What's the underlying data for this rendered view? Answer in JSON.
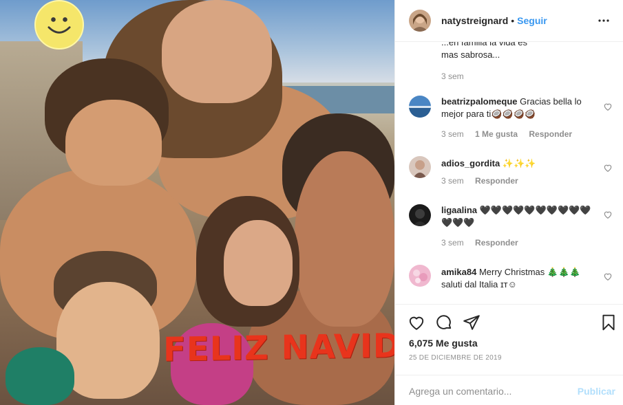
{
  "post": {
    "photo_caption": "FELIZ NAVIDAD!!"
  },
  "header": {
    "username": "natystreignard",
    "separator": "•",
    "follow_label": "Seguir"
  },
  "partial_comment": {
    "text_line1": "...en familia la vida es",
    "text_line2": "mas sabrosa...",
    "time": "3 sem"
  },
  "comments": [
    {
      "username": "beatrizpalomeque",
      "text": "Gracias bella lo mejor para ti🥥🥥🥥🥥",
      "time": "3 sem",
      "likes": "1 Me gusta",
      "reply": "Responder",
      "avatar_color": "#4a86c4"
    },
    {
      "username": "adios_gordita",
      "text": "✨✨✨",
      "time": "3 sem",
      "likes": "",
      "reply": "Responder",
      "avatar_color": "#7a5a4e"
    },
    {
      "username": "ligaalina",
      "text": "🖤🖤🖤🖤🖤🖤🖤🖤🖤🖤🖤🖤🖤",
      "time": "3 sem",
      "likes": "",
      "reply": "Responder",
      "avatar_color": "#1a1a1a"
    },
    {
      "username": "amika84",
      "text": "Merry Christmas 🎄🎄🎄 saluti dal Italia ɪт☺",
      "time": "",
      "likes": "",
      "reply": "",
      "avatar_color": "#f0b8cf"
    }
  ],
  "actions": {
    "likes_count": "6,075 Me gusta",
    "date": "25 DE DICIEMBRE DE 2019",
    "comment_placeholder": "Agrega un comentario...",
    "publish_label": "Publicar"
  },
  "icons": {
    "like": "heart-icon",
    "comment": "comment-icon",
    "share": "paper-plane-icon",
    "save": "bookmark-icon",
    "more": "ellipsis-icon"
  },
  "colors": {
    "accent_blue": "#3897f0",
    "publish_disabled": "#b2dffc",
    "caption_red": "#e8341c",
    "secondary_text": "#8e8e8e",
    "border": "#efefef"
  }
}
